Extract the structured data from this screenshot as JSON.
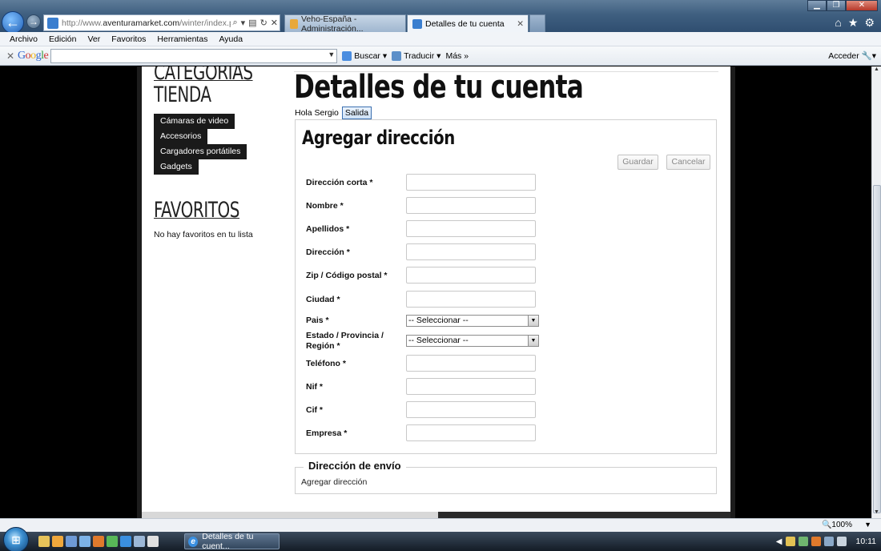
{
  "browser": {
    "url_prefix": "http://www.",
    "url_domain": "aventuramarket.com",
    "url_path": "/winter/index.php?",
    "tabs": [
      {
        "label": "Veho-España - Administración..."
      },
      {
        "label": "Detalles de tu cuenta"
      }
    ],
    "menu": [
      "Archivo",
      "Edición",
      "Ver",
      "Favoritos",
      "Herramientas",
      "Ayuda"
    ],
    "toolbar": {
      "search_label": "Buscar",
      "translate_label": "Traducir",
      "more_label": "Más »",
      "login_label": "Acceder"
    },
    "zoom": "100%"
  },
  "sidebar": {
    "categories_title_line1": "CATEGORIAS",
    "categories_title_line2": "TIENDA",
    "categories": [
      "Cámaras de video",
      "Accesorios",
      "Cargadores portátiles",
      "Gadgets"
    ],
    "favorites_title": "FAVORITOS",
    "favorites_empty": "No hay favoritos en tu lista"
  },
  "main": {
    "title": "Detalles de tu cuenta",
    "greeting": "Hola Sergio",
    "logout_label": "Salida",
    "form": {
      "title": "Agregar dirección",
      "save_label": "Guardar",
      "cancel_label": "Cancelar",
      "fields": [
        {
          "label": "Dirección corta *",
          "type": "text",
          "value": ""
        },
        {
          "label": "Nombre *",
          "type": "text",
          "value": ""
        },
        {
          "label": "Apellidos *",
          "type": "text",
          "value": ""
        },
        {
          "label": "Dirección *",
          "type": "text",
          "value": ""
        },
        {
          "label": "Zip / Código postal *",
          "type": "text",
          "value": ""
        },
        {
          "label": "Ciudad *",
          "type": "text",
          "value": ""
        },
        {
          "label": "Pais *",
          "type": "select",
          "value": "-- Seleccionar --"
        },
        {
          "label": "Estado / Provincia / Región *",
          "type": "select",
          "value": "-- Seleccionar --"
        },
        {
          "label": "Teléfono *",
          "type": "text",
          "value": ""
        },
        {
          "label": "Nif *",
          "type": "text",
          "value": ""
        },
        {
          "label": "Cif *",
          "type": "text",
          "value": ""
        },
        {
          "label": "Empresa *",
          "type": "text",
          "value": ""
        }
      ]
    },
    "shipping": {
      "legend": "Dirección de envío",
      "add_link": "Agregar dirección"
    }
  },
  "taskbar": {
    "task_label": "Detalles de tu cuent...",
    "clock": "10:11"
  }
}
